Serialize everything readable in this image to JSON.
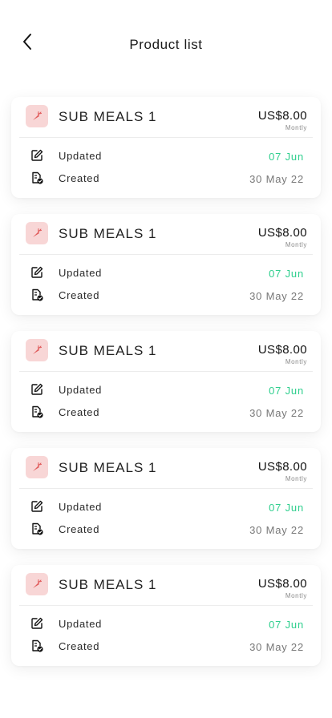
{
  "header": {
    "title": "Product list",
    "back_icon": "chevron-left-icon"
  },
  "colors": {
    "updated_date": "#2fcf8e",
    "thumb_bg": "#f8d6d6",
    "thumb_icon": "#e05a5a"
  },
  "products": [
    {
      "name": "SUB MEALS 1",
      "price": "US$8.00",
      "period": "Montly",
      "updated_label": "Updated",
      "updated_date": "07 Jun",
      "created_label": "Created",
      "created_date": "30 May 22"
    },
    {
      "name": "SUB MEALS 1",
      "price": "US$8.00",
      "period": "Montly",
      "updated_label": "Updated",
      "updated_date": "07 Jun",
      "created_label": "Created",
      "created_date": "30 May 22"
    },
    {
      "name": "SUB MEALS 1",
      "price": "US$8.00",
      "period": "Montly",
      "updated_label": "Updated",
      "updated_date": "07 Jun",
      "created_label": "Created",
      "created_date": "30 May 22"
    },
    {
      "name": "SUB MEALS 1",
      "price": "US$8.00",
      "period": "Montly",
      "updated_label": "Updated",
      "updated_date": "07 Jun",
      "created_label": "Created",
      "created_date": "30 May 22"
    },
    {
      "name": "SUB MEALS 1",
      "price": "US$8.00",
      "period": "Montly",
      "updated_label": "Updated",
      "updated_date": "07 Jun",
      "created_label": "Created",
      "created_date": "30 May 22"
    }
  ]
}
